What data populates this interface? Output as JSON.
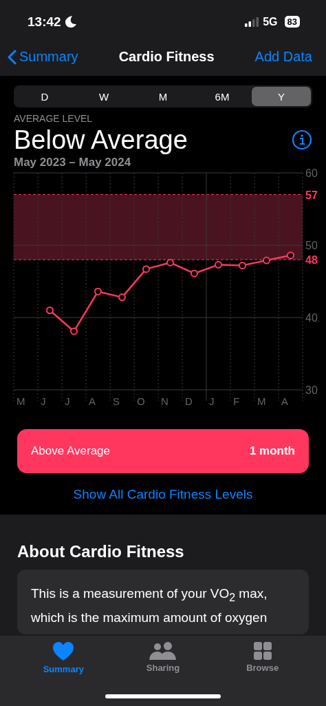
{
  "status_bar": {
    "time": "13:42",
    "network": "5G",
    "battery": "83"
  },
  "nav": {
    "back": "Summary",
    "title": "Cardio Fitness",
    "action": "Add Data"
  },
  "ranges": [
    {
      "label": "D",
      "selected": false
    },
    {
      "label": "W",
      "selected": false
    },
    {
      "label": "M",
      "selected": false
    },
    {
      "label": "6M",
      "selected": false
    },
    {
      "label": "Y",
      "selected": true
    }
  ],
  "summary": {
    "caption": "AVERAGE LEVEL",
    "value": "Below Average",
    "period": "May 2023 – May 2024"
  },
  "chart_data": {
    "type": "line",
    "categories": [
      "M",
      "J",
      "J",
      "A",
      "S",
      "O",
      "N",
      "D",
      "J",
      "F",
      "M",
      "A"
    ],
    "series": [
      {
        "color": "#ff375f",
        "marker": "o",
        "values": [
          null,
          41,
          38.1,
          43.6,
          42.8,
          46.7,
          47.6,
          46.1,
          47.3,
          47.2,
          47.9,
          48.6
        ]
      }
    ],
    "ylim": [
      30,
      60
    ],
    "yticks": [
      30,
      40,
      50,
      60
    ],
    "bands": [
      {
        "axis": "y",
        "from": 48,
        "to": 57,
        "color": "#4a1320"
      }
    ],
    "ref_lines": [
      {
        "axis": "y",
        "value": 57,
        "label": "57",
        "color": "#ff375f"
      },
      {
        "axis": "y",
        "value": 48,
        "label": "48",
        "color": "#ff375f"
      }
    ]
  },
  "level_card": {
    "label": "Above Average",
    "duration": "1 month"
  },
  "show_all_link": "Show All Cardio Fitness Levels",
  "about": {
    "title": "About Cardio Fitness",
    "text": "This is a measurement of your VO$_{2}$ max, which is the maximum amount of oxygen"
  },
  "tab_bar": [
    {
      "kind": "heart",
      "label": "Summary",
      "selected": true
    },
    {
      "kind": "people",
      "label": "Sharing",
      "selected": false
    },
    {
      "kind": "grid",
      "label": "Browse",
      "selected": false
    }
  ]
}
